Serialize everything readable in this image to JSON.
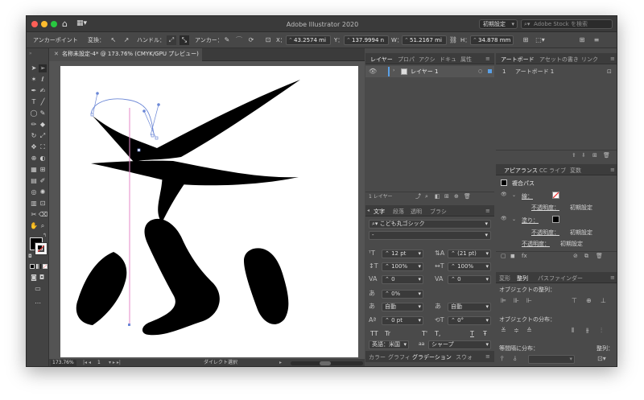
{
  "titlebar": {
    "title": "Adobe Illustrator 2020",
    "workspace": "初期設定",
    "search_placeholder": "Adobe Stock を検索"
  },
  "controlbar": {
    "selection_label": "アンカーポイント",
    "convert_label": "変換：",
    "handle_label": "ハンドル：",
    "anchor_label": "アンカー：",
    "x_label": "X：",
    "x_value": "43.2574 mi",
    "y_label": "Y：",
    "y_value": "137.9994 n",
    "w_label": "W：",
    "w_value": "51.2167 mi",
    "h_label": "H：",
    "h_value": "34.878 mm"
  },
  "document": {
    "tab_title": "名称未設定-4* @ 173.76% (CMYK/GPU プレビュー)"
  },
  "statusbar": {
    "zoom": "173.76%",
    "artboard_num": "1",
    "tool_name": "ダイレクト選択"
  },
  "layers_panel": {
    "tabs": [
      "レイヤー",
      "プロパ",
      "アクシ",
      "ドキュ",
      "属性"
    ],
    "layer_name": "レイヤー 1",
    "footer_count": "1 レイヤー"
  },
  "artboards_panel": {
    "tabs": [
      "アートボード",
      "アセットの書き",
      "リンク"
    ],
    "row_num": "1",
    "row_name": "アートボード 1"
  },
  "appearance_panel": {
    "tabs": [
      "アピアランス",
      "CC ライブ",
      "変数"
    ],
    "title": "複合パス",
    "stroke_label": "線：",
    "opacity_label": "不透明度：",
    "opacity_value": "初期設定",
    "fill_label": "塗り：",
    "fill_opacity_label": "不透明度：",
    "fill_opacity_value": "初期設定",
    "overall_opacity_label": "不透明度：",
    "overall_opacity_value": "初期設定"
  },
  "type_panel": {
    "tabs": [
      "文字",
      "段落",
      "透明",
      "ブラシ"
    ],
    "font_family": "こども丸ゴシック",
    "font_style": "-",
    "font_size": "12 pt",
    "leading": "(21 pt)",
    "vscale": "100%",
    "hscale": "100%",
    "kerning": "0",
    "tracking": "0",
    "tsume": "0%",
    "aki_left": "自動",
    "aki_right": "自動",
    "baseline": "0 pt",
    "rotation": "0°",
    "btn_tt": "TT",
    "btn_tr": "Tr",
    "btn_sup": "T'",
    "btn_sub": "T,",
    "btn_under": "T",
    "btn_strike": "Ŧ",
    "language": "英語：米国",
    "aa": "aa",
    "aa_value": "シャープ"
  },
  "bottom_tabs": {
    "tabs": [
      "カラー",
      "グラフィ",
      "グラデーション",
      "スウォ"
    ]
  },
  "align_panel": {
    "tabs": [
      "変形",
      "整列",
      "パスファインダー"
    ],
    "align_objects_label": "オブジェクトの整列：",
    "distribute_objects_label": "オブジェクトの分布：",
    "distribute_spacing_label": "等間隔に分布：",
    "align_to_label": "整列："
  },
  "colors": {
    "accent": "#5aa0e6",
    "pink_guide": "#e68ac8",
    "selection_blue": "#6b87d6"
  }
}
